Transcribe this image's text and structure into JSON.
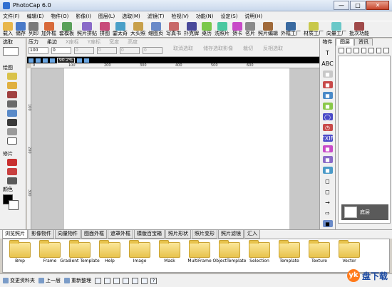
{
  "window": {
    "title": "PhotoCap 6.0",
    "minimize": "—",
    "maximize": "□",
    "close": "✕"
  },
  "menu": [
    "文件(F)",
    "编辑(E)",
    "物件(O)",
    "影像(I)",
    "图层(L)",
    "选取(M)",
    "滤镜(T)",
    "检视(V)",
    "功能(N)",
    "设定(S)",
    "说明(H)"
  ],
  "toolbar": [
    {
      "label": "载入",
      "color": "#e8b64a"
    },
    {
      "label": "储存",
      "color": "#4a7ac8"
    },
    {
      "label": "列印",
      "color": "#7a7a7a"
    },
    {
      "label": "加外框",
      "color": "#d86a3a"
    },
    {
      "label": "套模板",
      "color": "#5aa05a"
    },
    {
      "label": "照片拼贴",
      "color": "#8a6ac8"
    },
    {
      "label": "拼图",
      "color": "#c84a7a"
    },
    {
      "label": "霎太奇",
      "color": "#4aa0c8"
    },
    {
      "label": "大头照",
      "color": "#c8a04a"
    },
    {
      "label": "缩图页",
      "color": "#6a8ac8"
    },
    {
      "label": "写真书",
      "color": "#c86a6a"
    },
    {
      "label": "扑克牌",
      "color": "#4a4a9a"
    },
    {
      "label": "桌历",
      "color": "#7ac84a"
    },
    {
      "label": "洗照片",
      "color": "#4ac8a0"
    },
    {
      "label": "贺卡",
      "color": "#c84ac8"
    },
    {
      "label": "名片",
      "color": "#8a8a8a"
    },
    {
      "label": "照片编辑",
      "color": "#a06a3a"
    },
    {
      "label": "外框工厂",
      "color": "#3a6aa0"
    },
    {
      "label": "材质工厂",
      "color": "#c8c84a"
    },
    {
      "label": "向量工厂",
      "color": "#6ac8c8"
    },
    {
      "label": "批次功能",
      "color": "#a04a4a"
    }
  ],
  "left_panel": {
    "select_label": "选取",
    "draw_label": "绘图",
    "repair_label": "修片",
    "color_label": "颜色",
    "fg_color": "#000000",
    "bg_color": "#ffffff"
  },
  "props": {
    "labels": [
      "压力",
      "柔边",
      "X座标",
      "Y座标",
      "宽度",
      "高度"
    ],
    "values": [
      "100",
      "0",
      "0",
      "0",
      "0",
      "0"
    ],
    "unit": "PIXEL",
    "actions": [
      "取消选取",
      "储存选取影像",
      "裁切",
      "反相选取"
    ]
  },
  "canvas": {
    "zoom": "90.2%",
    "ruler_top": [
      "0",
      "100",
      "200",
      "300",
      "400",
      "500",
      "600"
    ],
    "ruler_left": [
      "100",
      "200",
      "300"
    ]
  },
  "right_strip": {
    "label": "物件",
    "tools": [
      "T",
      "ABC",
      "◼",
      "◼",
      "◼",
      "◼",
      "◯",
      "◷",
      "EXIF",
      "◼",
      "◼",
      "◼",
      "◻",
      "◻",
      "→",
      "⇨",
      "◼",
      "◼"
    ]
  },
  "right_panel": {
    "tabs": [
      "图层",
      "资讯"
    ],
    "layer_name": "底层"
  },
  "bottom_tabs": [
    "浏览照片",
    "影像物件",
    "向量物件",
    "图面外框",
    "遮罩外框",
    "模版百宝箱",
    "照片形状",
    "照片变形",
    "照片滤镜",
    "汇入"
  ],
  "folders": [
    "Bmp",
    "Frame",
    "Gradient Template",
    "Help",
    "Image",
    "Mask",
    "MultiFrame",
    "ObjectTemplate",
    "Selection",
    "Template",
    "Texture",
    "Vector"
  ],
  "status": {
    "change_folder": "变更资料夹",
    "up_level": "上一层",
    "refresh": "重新整理",
    "help": "?"
  },
  "watermark": {
    "logo": "yk",
    "text": "盘下载"
  }
}
